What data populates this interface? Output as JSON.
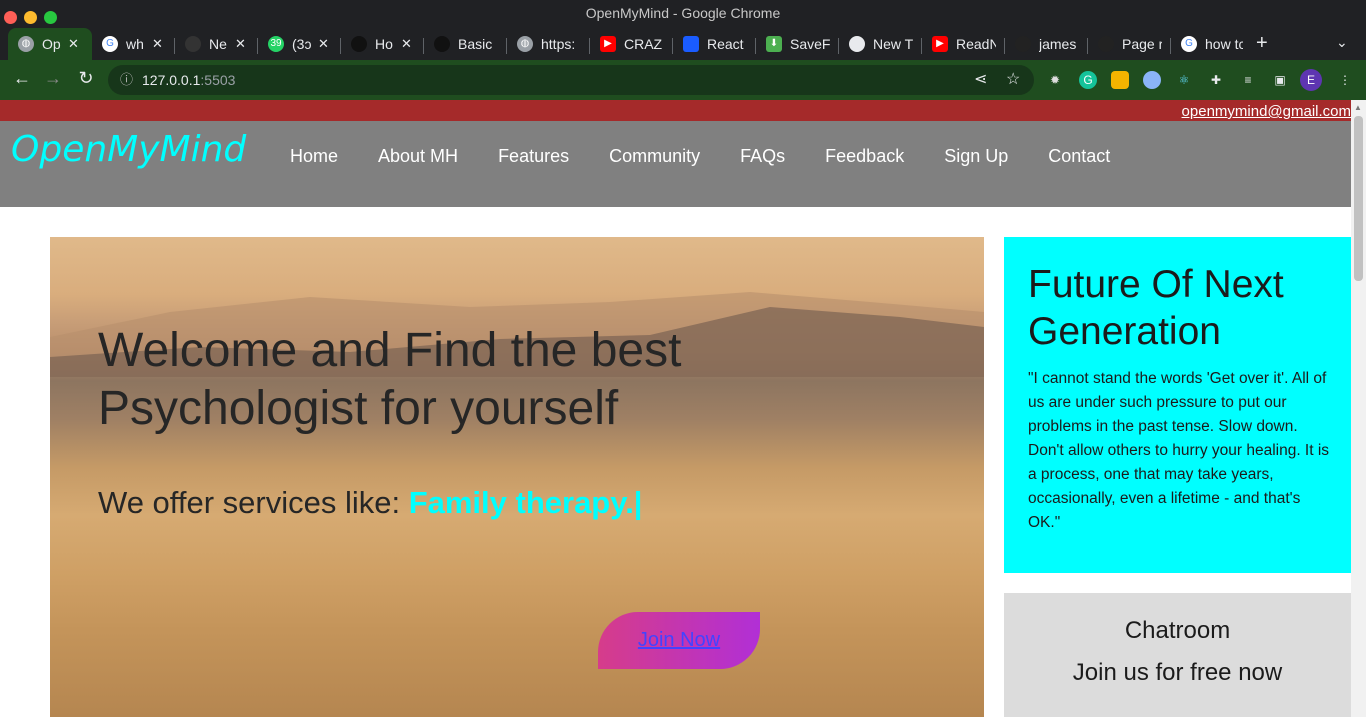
{
  "window": {
    "title": "OpenMyMind - Google Chrome"
  },
  "tabs": [
    {
      "label": "Op",
      "icon": "globe-icon"
    },
    {
      "label": "wh",
      "icon": "google-icon"
    },
    {
      "label": "Ne",
      "icon": "github-icon"
    },
    {
      "label": "(3ɔ",
      "icon": "whatsapp-icon"
    },
    {
      "label": "Ho",
      "icon": "site-icon"
    },
    {
      "label": "Basic",
      "icon": "github-icon"
    },
    {
      "label": "https:",
      "icon": "globe-icon"
    },
    {
      "label": "CRAZ",
      "icon": "youtube-icon"
    },
    {
      "label": "React",
      "icon": "site-icon"
    },
    {
      "label": "SaveF",
      "icon": "download-icon"
    },
    {
      "label": "New T",
      "icon": "chrome-icon"
    },
    {
      "label": "ReadN",
      "icon": "youtube-icon"
    },
    {
      "label": "james",
      "icon": "github-icon"
    },
    {
      "label": "Page r",
      "icon": "github-icon"
    },
    {
      "label": "how tc",
      "icon": "google-icon"
    }
  ],
  "address": {
    "host": "127.0.0.1",
    "port": ":5503"
  },
  "site": {
    "email": "openmymind@gmail.com",
    "logo": "OpenMyMind",
    "nav": [
      "Home",
      "About MH",
      "Features",
      "Community",
      "FAQs",
      "Feedback",
      "Sign Up",
      "Contact"
    ],
    "hero": {
      "heading": "Welcome and Find the best Psychologist for yourself",
      "services_prefix": "We offer services like: ",
      "services_value": "Family therapy.|",
      "join": "Join Now"
    },
    "future": {
      "title": "Future Of Next Generation",
      "quote": "\"I cannot stand the words 'Get over it'. All of us are under such pressure to put our problems in the past tense. Slow down. Don't allow others to hurry your healing. It is a process, one that may take years, occasionally, even a lifetime - and that's OK.\""
    },
    "chat": {
      "title": "Chatroom",
      "subtitle": "Join us for free now"
    }
  },
  "colors": {
    "accent": "#00ffff",
    "redbar": "#a52a2a",
    "header": "#808080"
  }
}
